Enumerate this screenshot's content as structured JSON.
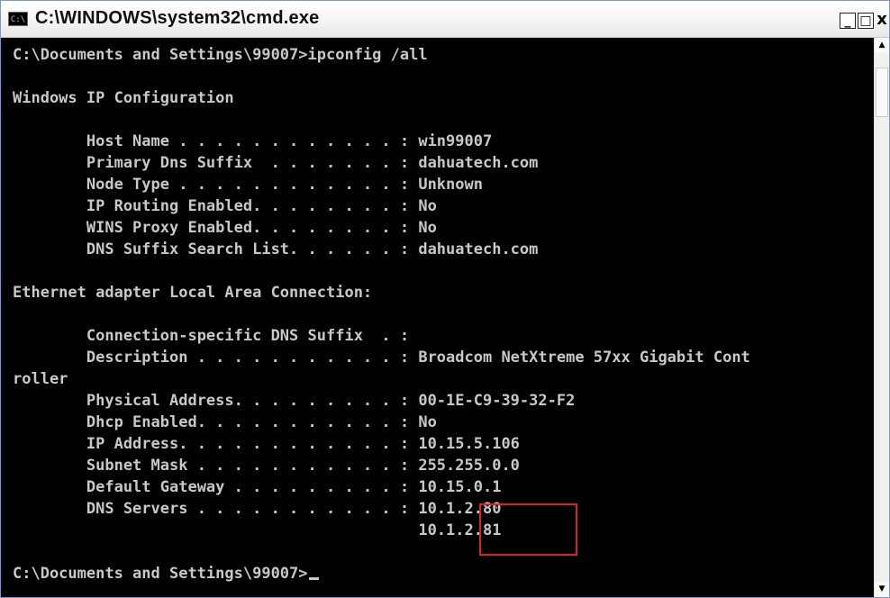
{
  "window": {
    "title": "C:\\WINDOWS\\system32\\cmd.exe",
    "icon_label": "C:\\",
    "minimize_glyph": "_",
    "maximize_glyph": "□",
    "close_glyph": "x"
  },
  "console": {
    "lines": [
      "C:\\Documents and Settings\\99007>ipconfig /all",
      "",
      "Windows IP Configuration",
      "",
      "        Host Name . . . . . . . . . . . . : win99007",
      "        Primary Dns Suffix  . . . . . . . : dahuatech.com",
      "        Node Type . . . . . . . . . . . . : Unknown",
      "        IP Routing Enabled. . . . . . . . : No",
      "        WINS Proxy Enabled. . . . . . . . : No",
      "        DNS Suffix Search List. . . . . . : dahuatech.com",
      "",
      "Ethernet adapter Local Area Connection:",
      "",
      "        Connection-specific DNS Suffix  . :",
      "        Description . . . . . . . . . . . : Broadcom NetXtreme 57xx Gigabit Cont",
      "roller",
      "        Physical Address. . . . . . . . . : 00-1E-C9-39-32-F2",
      "        Dhcp Enabled. . . . . . . . . . . : No",
      "        IP Address. . . . . . . . . . . . : 10.15.5.106",
      "        Subnet Mask . . . . . . . . . . . : 255.255.0.0",
      "        Default Gateway . . . . . . . . . : 10.15.0.1",
      "        DNS Servers . . . . . . . . . . . : 10.1.2.80",
      "                                            10.1.2.81",
      "",
      "C:\\Documents and Settings\\99007>"
    ],
    "text_color": "#c8c8c8",
    "background": "#000000",
    "highlight_color": "#e02020"
  },
  "scrollbar": {
    "up_glyph": "▲",
    "down_glyph": "▼"
  }
}
